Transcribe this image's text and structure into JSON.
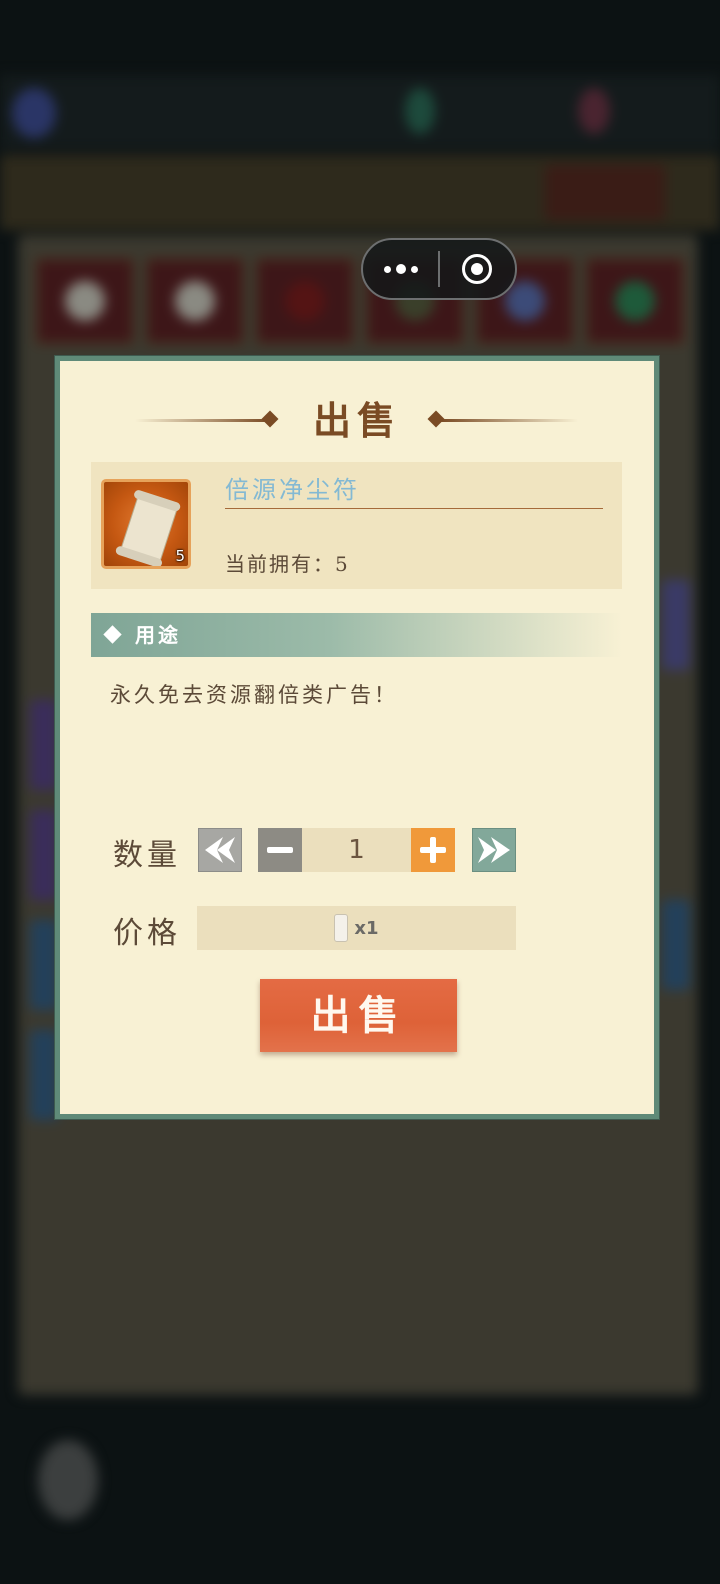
{
  "dialog": {
    "title": "出售",
    "item": {
      "name": "倍源净尘符",
      "badge_count": "5",
      "owned_text": "当前拥有：5"
    },
    "usage_label": "用途",
    "description": "永久免去资源翻倍类广告！",
    "quantity": {
      "label": "数量",
      "value": "1",
      "min_icon": "double-chevron-left-icon",
      "decrement_icon": "minus-icon",
      "increment_icon": "plus-icon",
      "max_icon": "double-chevron-right-icon"
    },
    "price": {
      "label": "价格",
      "amount_text": "x1",
      "currency_icon": "scroll-token-icon"
    },
    "sell_button_label": "出售"
  },
  "capsule": {
    "more_icon": "more-dots-icon",
    "close_icon": "target-close-icon"
  },
  "colors": {
    "dialog_bg": "#f8f1d4",
    "dialog_border": "#5f8a78",
    "title": "#7a4b24",
    "item_name": "#83b9d3",
    "sell_button": "#e46b44",
    "increment_button": "#f0993a",
    "max_button": "#82a89a"
  }
}
